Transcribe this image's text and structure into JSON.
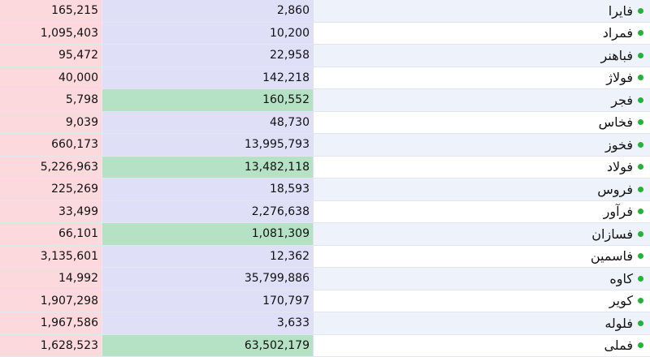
{
  "rows": [
    {
      "name": "فایرا",
      "volume": "2,860",
      "value": "165,215",
      "highlight": false
    },
    {
      "name": "فمراد",
      "volume": "10,200",
      "value": "1,095,403",
      "highlight": false
    },
    {
      "name": "فباهنر",
      "volume": "22,958",
      "value": "95,472",
      "highlight": false
    },
    {
      "name": "فولاژ",
      "volume": "142,218",
      "value": "40,000",
      "highlight": false
    },
    {
      "name": "فجر",
      "volume": "160,552",
      "value": "5,798",
      "highlight": true
    },
    {
      "name": "فخاس",
      "volume": "48,730",
      "value": "9,039",
      "highlight": false
    },
    {
      "name": "فخوز",
      "volume": "13,995,793",
      "value": "660,173",
      "highlight": false
    },
    {
      "name": "فولاد",
      "volume": "13,482,118",
      "value": "5,226,963",
      "highlight": true
    },
    {
      "name": "فروس",
      "volume": "18,593",
      "value": "225,269",
      "highlight": false
    },
    {
      "name": "فرآور",
      "volume": "2,276,638",
      "value": "33,499",
      "highlight": false
    },
    {
      "name": "فسازان",
      "volume": "1,081,309",
      "value": "66,101",
      "highlight": true
    },
    {
      "name": "فاسمین",
      "volume": "12,362",
      "value": "3,135,601",
      "highlight": false
    },
    {
      "name": "کاوه",
      "volume": "35,799,886",
      "value": "14,992",
      "highlight": false
    },
    {
      "name": "کویر",
      "volume": "170,797",
      "value": "1,907,298",
      "highlight": false
    },
    {
      "name": "فلوله",
      "volume": "3,633",
      "value": "1,967,586",
      "highlight": false
    },
    {
      "name": "فملی",
      "volume": "63,502,179",
      "value": "1,628,523",
      "highlight": true
    }
  ],
  "colors": {
    "status_dot": "#22b436",
    "highlight": "#b5e2c5",
    "col_volume_bg": "#dfe0f8",
    "col_value_bg": "#fbd9dc"
  }
}
